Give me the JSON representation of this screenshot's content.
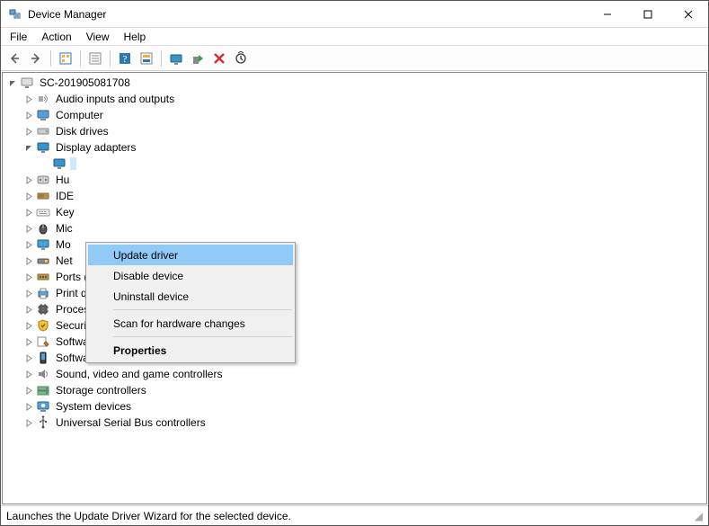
{
  "window": {
    "title": "Device Manager"
  },
  "menubar": {
    "file": "File",
    "action": "Action",
    "view": "View",
    "help": "Help"
  },
  "tree": {
    "root": {
      "label": "SC-201905081708"
    },
    "categories": [
      {
        "label": "Audio inputs and outputs",
        "icon": "audio",
        "expanded": false
      },
      {
        "label": "Computer",
        "icon": "computer",
        "expanded": false
      },
      {
        "label": "Disk drives",
        "icon": "disk",
        "expanded": false
      },
      {
        "label": "Display adapters",
        "icon": "display",
        "expanded": true
      },
      {
        "label": "Human Interface Devices",
        "icon": "hid",
        "expanded": false,
        "truncated": "Hu"
      },
      {
        "label": "IDE ATA/ATAPI controllers",
        "icon": "ide",
        "expanded": false,
        "truncated": "IDE"
      },
      {
        "label": "Keyboards",
        "icon": "keyboard",
        "expanded": false,
        "truncated": "Key"
      },
      {
        "label": "Mice and other pointing devices",
        "icon": "mouse",
        "expanded": false,
        "truncated": "Mic"
      },
      {
        "label": "Monitors",
        "icon": "monitor",
        "expanded": false,
        "truncated": "Mo"
      },
      {
        "label": "Network adapters",
        "icon": "network",
        "expanded": false,
        "truncated": "Net"
      },
      {
        "label": "Ports (COM & LPT)",
        "icon": "port",
        "expanded": false
      },
      {
        "label": "Print queues",
        "icon": "printer",
        "expanded": false
      },
      {
        "label": "Processors",
        "icon": "cpu",
        "expanded": false
      },
      {
        "label": "Security devices",
        "icon": "security",
        "expanded": false
      },
      {
        "label": "Software components",
        "icon": "swcomp",
        "expanded": false
      },
      {
        "label": "Software devices",
        "icon": "swdev",
        "expanded": false
      },
      {
        "label": "Sound, video and game controllers",
        "icon": "sound",
        "expanded": false
      },
      {
        "label": "Storage controllers",
        "icon": "storage",
        "expanded": false
      },
      {
        "label": "System devices",
        "icon": "system",
        "expanded": false
      },
      {
        "label": "Universal Serial Bus controllers",
        "icon": "usb",
        "expanded": false
      }
    ]
  },
  "context_menu": {
    "update": "Update driver",
    "disable": "Disable device",
    "uninstall": "Uninstall device",
    "scan": "Scan for hardware changes",
    "properties": "Properties",
    "highlighted": "update"
  },
  "statusbar": {
    "text": "Launches the Update Driver Wizard for the selected device."
  }
}
